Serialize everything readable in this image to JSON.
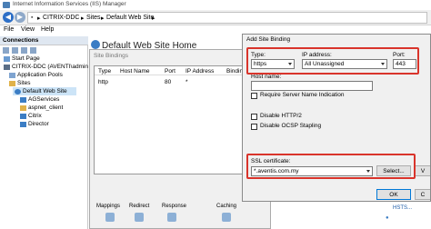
{
  "window": {
    "title": "Internet Information Services (IIS) Manager"
  },
  "address": {
    "path": [
      "CITRIX-DDC",
      "Sites",
      "Default Web Site"
    ],
    "sep": "▸"
  },
  "menu": [
    "File",
    "View",
    "Help"
  ],
  "connections": {
    "title": "Connections",
    "tree": [
      {
        "label": "Start Page"
      },
      {
        "label": "CITRIX-DDC (AVENTI\\admin"
      },
      {
        "label": "Application Pools"
      },
      {
        "label": "Sites"
      },
      {
        "label": "Default Web Site"
      },
      {
        "label": "AGServices"
      },
      {
        "label": "aspnet_client"
      },
      {
        "label": "Citrix"
      },
      {
        "label": "Director"
      }
    ]
  },
  "page": {
    "title": "Default Web Site Home"
  },
  "site_bindings": {
    "title": "Site Bindings",
    "columns": [
      "Type",
      "Host Name",
      "Port",
      "IP Address",
      "Binding"
    ],
    "rows": [
      {
        "type": "http",
        "host": "",
        "port": "80",
        "ip": "*"
      }
    ]
  },
  "dialog": {
    "title": "Add Site Binding",
    "type_label": "Type:",
    "type_value": "https",
    "ip_label": "IP address:",
    "ip_value": "All Unassigned",
    "port_label": "Port:",
    "port_value": "443",
    "hostname_label": "Host name:",
    "hostname_value": "",
    "checks": [
      "Require Server Name Indication",
      "Disable HTTP/2",
      "Disable OCSP Stapling"
    ],
    "ssl_label": "SSL certificate:",
    "ssl_value": "*.aventis.com.my",
    "select_label": "Select...",
    "view_label": "V",
    "ok_label": "OK",
    "cancel_label": "C"
  },
  "features": [
    "Mappings",
    "Redirect",
    "Response",
    "Caching"
  ],
  "actions": {
    "hsts_link": "HSTS..."
  },
  "colors": {
    "highlight": "#d9342b",
    "selection": "#cce4f7",
    "accent": "#2d6fc7"
  }
}
